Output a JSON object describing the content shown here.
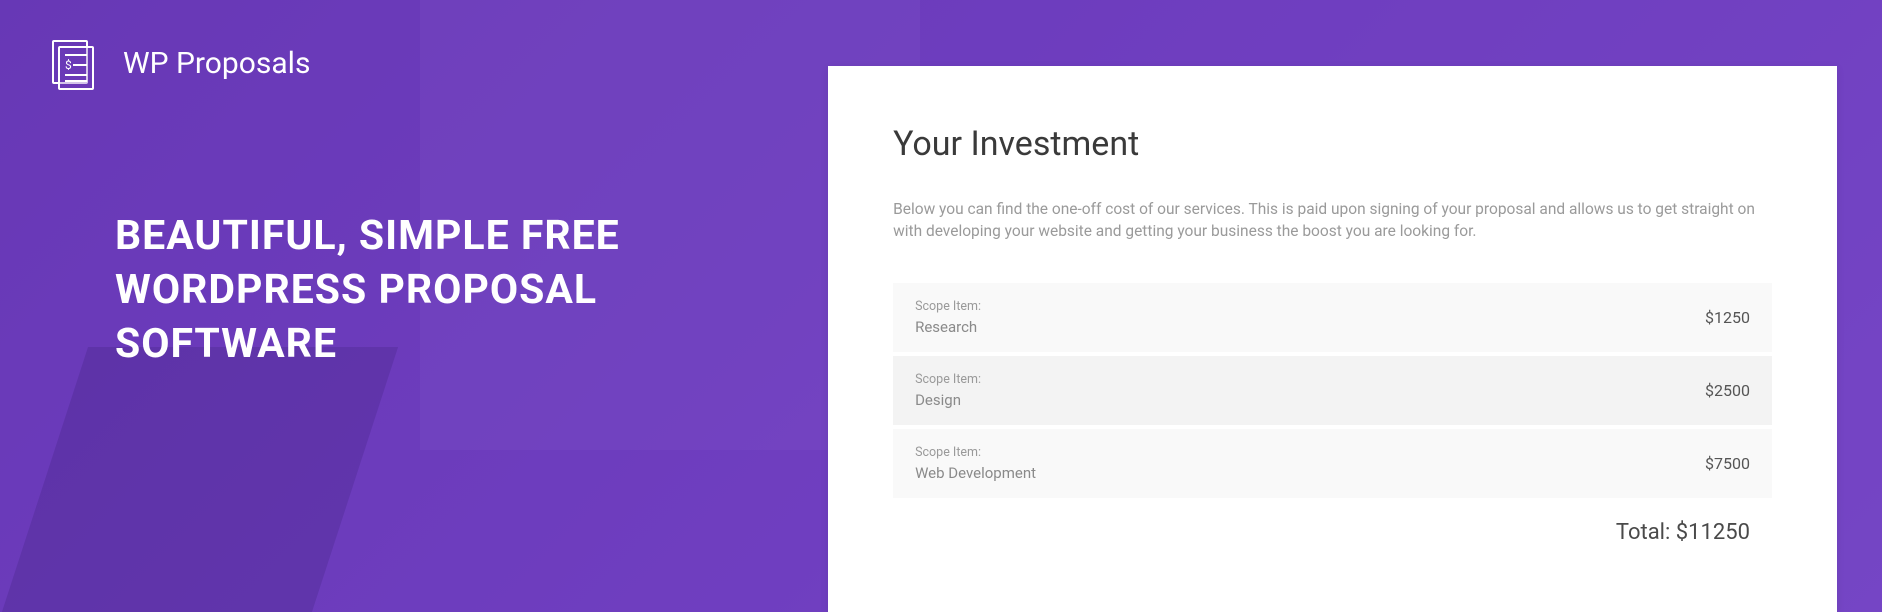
{
  "brand": {
    "name": "WP Proposals"
  },
  "hero": {
    "headline_line1": "BEAUTIFUL, SIMPLE FREE",
    "headline_line2": "WORDPRESS PROPOSAL SOFTWARE"
  },
  "card": {
    "title": "Your Investment",
    "description": "Below you can find the one-off cost of our services. This is paid upon signing of your proposal and allows us to get straight on with developing your website and getting your business the boost you are looking for.",
    "scope_label": "Scope Item:",
    "items": [
      {
        "name": "Research",
        "price": "$1250"
      },
      {
        "name": "Design",
        "price": "$2500"
      },
      {
        "name": "Web Development",
        "price": "$7500"
      }
    ],
    "total_label": "Total: $11250"
  }
}
